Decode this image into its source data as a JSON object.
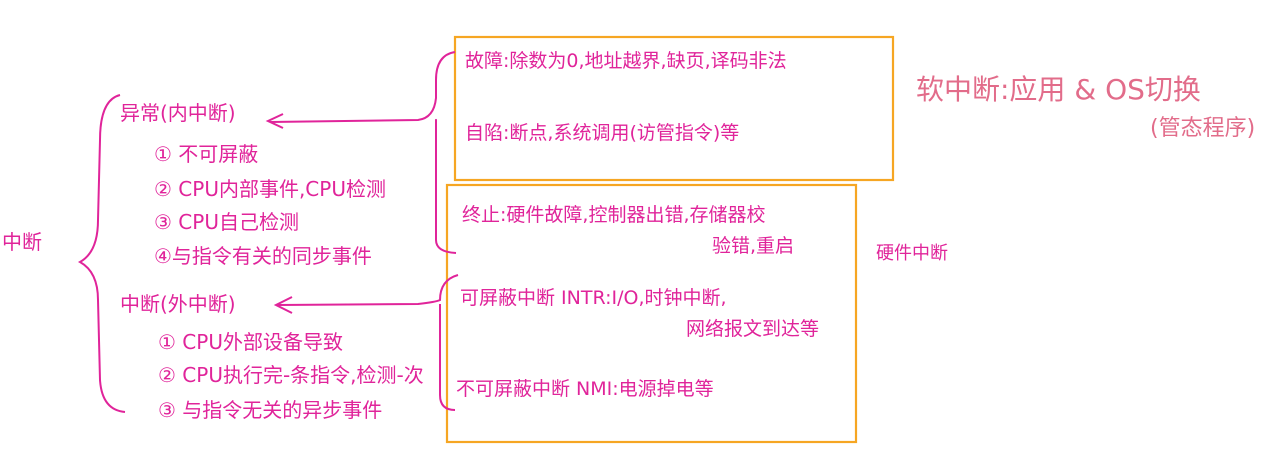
{
  "root": {
    "label": "中断"
  },
  "exception": {
    "title": "异常(内中断)",
    "items": [
      "① 不可屏蔽",
      "② CPU内部事件,CPU检测",
      "③ CPU自己检测",
      "④与指令有关的同步事件"
    ]
  },
  "interrupt": {
    "title": "中断(外中断)",
    "items": [
      "① CPU外部设备导致",
      "② CPU执行完-条指令,检测-次",
      "③ 与指令无关的异步事件"
    ]
  },
  "soft_box": {
    "fault": "故障:除数为0,地址越界,缺页,译码非法",
    "trap": "自陷:断点,系统调用(访管指令)等"
  },
  "hard_box": {
    "abort_line1": "终止:硬件故障,控制器出错,存储器校",
    "abort_line2": "验错,重启",
    "intr_line1": "可屏蔽中断 INTR:I/O,时钟中断,",
    "intr_line2": "网络报文到达等",
    "nmi": "不可屏蔽中断 NMI:电源掉电等"
  },
  "soft_interrupt": {
    "title": "软中断:应用 & OS切换",
    "subtitle": "(管态程序)"
  },
  "hard_interrupt": {
    "label": "硬件中断"
  },
  "colors": {
    "ink": "#e0249a",
    "box_border": "#f6a623",
    "soft_ink": "#e26c8a"
  }
}
